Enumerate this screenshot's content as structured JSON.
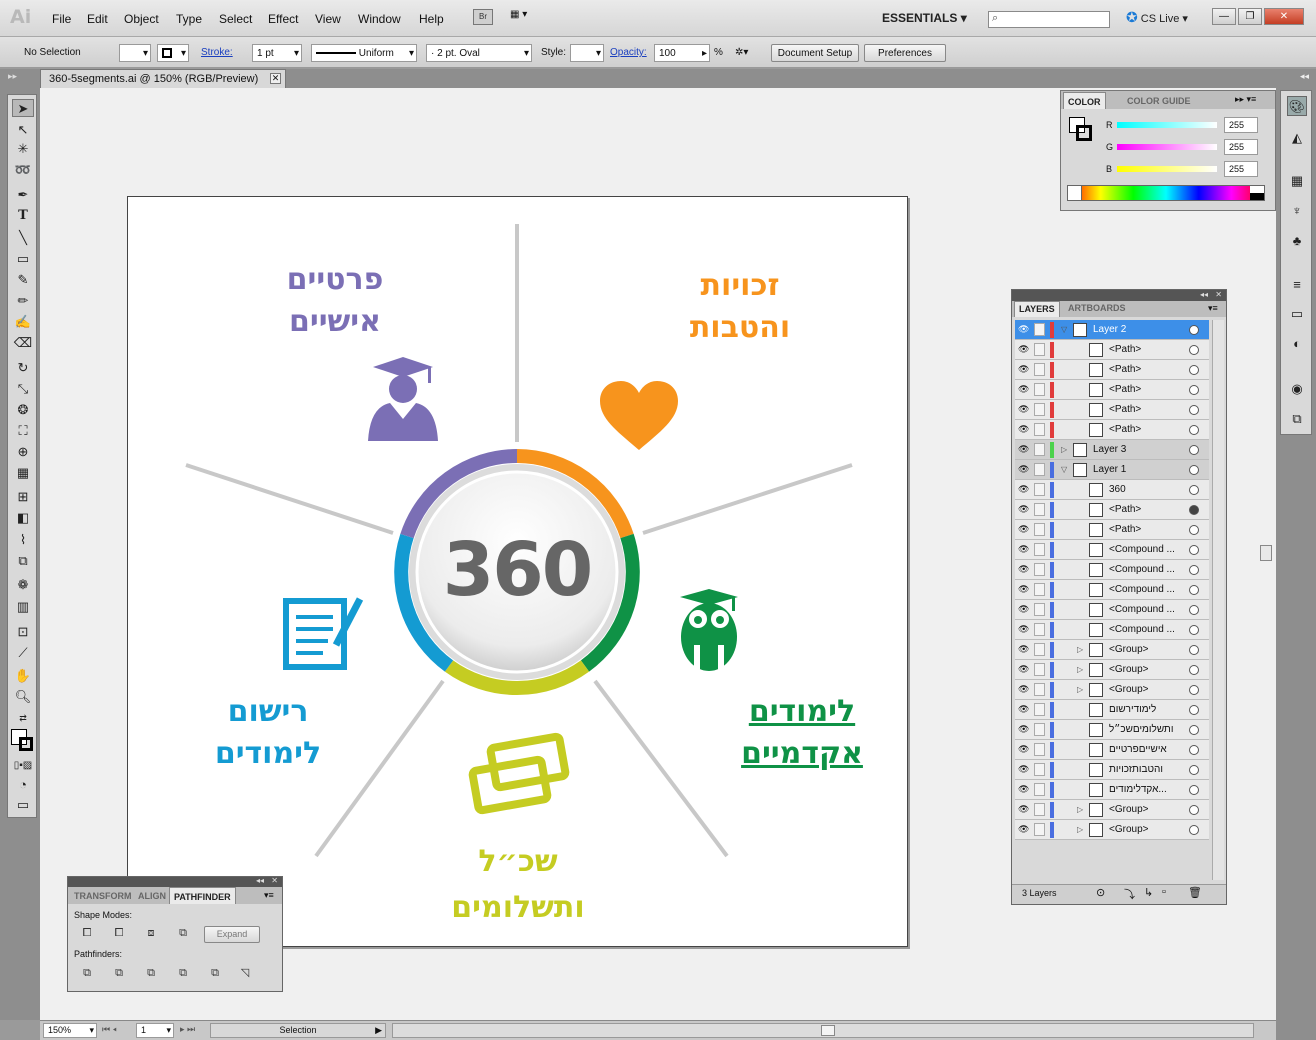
{
  "app": {
    "logo": "Ai",
    "menu": [
      "File",
      "Edit",
      "Object",
      "Type",
      "Select",
      "Effect",
      "View",
      "Window",
      "Help"
    ],
    "bridge_label": "Br",
    "workspace": "ESSENTIALS",
    "cs_live": "CS Live"
  },
  "control_bar": {
    "selection": "No Selection",
    "stroke_label": "Stroke:",
    "stroke_weight": "1 pt",
    "profile": "Uniform",
    "brush": "2 pt. Oval",
    "style_label": "Style:",
    "opacity_label": "Opacity:",
    "opacity_value": "100",
    "percent": "%",
    "doc_setup": "Document Setup",
    "preferences": "Preferences"
  },
  "document": {
    "tab_title": "360-5segments.ai @ 150% (RGB/Preview)"
  },
  "artwork": {
    "center_text": "360",
    "segments": [
      {
        "line1": "פרטיים",
        "line2": "אישיים",
        "color": "#7b6fb5"
      },
      {
        "line1": "זכויות",
        "line2": "והטבות",
        "color": "#f7941d"
      },
      {
        "line1": "לימודים",
        "line2": "אקדמיים",
        "color": "#0f9246"
      },
      {
        "line1": "שכ״ל",
        "line2": "ותשלומים",
        "color": "#c5cc22"
      },
      {
        "line1": "רישום",
        "line2": "לימודים",
        "color": "#149bd2"
      }
    ]
  },
  "color_panel": {
    "tabs": [
      "COLOR",
      "COLOR GUIDE"
    ],
    "channels": [
      {
        "label": "R",
        "value": "255",
        "color": "#26c6c6"
      },
      {
        "label": "G",
        "value": "255",
        "color": "#d830c6"
      },
      {
        "label": "B",
        "value": "255",
        "color": "#e3e330"
      }
    ]
  },
  "layers_panel": {
    "tabs": [
      "LAYERS",
      "ARTBOARDS"
    ],
    "rows": [
      {
        "name": "Layer 2",
        "kind": "layer",
        "selected": true,
        "color": "#e03c3c"
      },
      {
        "name": "<Path>",
        "kind": "item",
        "color": "#e03c3c"
      },
      {
        "name": "<Path>",
        "kind": "item",
        "color": "#e03c3c"
      },
      {
        "name": "<Path>",
        "kind": "item",
        "color": "#e03c3c"
      },
      {
        "name": "<Path>",
        "kind": "item",
        "color": "#e03c3c"
      },
      {
        "name": "<Path>",
        "kind": "item",
        "color": "#e03c3c"
      },
      {
        "name": "Layer 3",
        "kind": "layer",
        "color": "#4cd24c"
      },
      {
        "name": "Layer 1",
        "kind": "layer",
        "color": "#4a6ee0"
      },
      {
        "name": "360",
        "kind": "item",
        "color": "#4a6ee0"
      },
      {
        "name": "<Path>",
        "kind": "item",
        "color": "#4a6ee0",
        "target_filled": true
      },
      {
        "name": "<Path>",
        "kind": "item",
        "color": "#4a6ee0"
      },
      {
        "name": "<Compound ...",
        "kind": "item",
        "color": "#4a6ee0"
      },
      {
        "name": "<Compound ...",
        "kind": "item",
        "color": "#4a6ee0"
      },
      {
        "name": "<Compound ...",
        "kind": "item",
        "color": "#4a6ee0"
      },
      {
        "name": "<Compound ...",
        "kind": "item",
        "color": "#4a6ee0"
      },
      {
        "name": "<Compound ...",
        "kind": "item",
        "color": "#4a6ee0"
      },
      {
        "name": "<Group>",
        "kind": "group",
        "color": "#4a6ee0"
      },
      {
        "name": "<Group>",
        "kind": "group",
        "color": "#4a6ee0"
      },
      {
        "name": "<Group>",
        "kind": "group",
        "color": "#4a6ee0"
      },
      {
        "name": "לימודירשום",
        "kind": "item",
        "color": "#4a6ee0"
      },
      {
        "name": "ותשלומיםשכ״ל",
        "kind": "item",
        "color": "#4a6ee0"
      },
      {
        "name": "אישייםפרטיים",
        "kind": "item",
        "color": "#4a6ee0"
      },
      {
        "name": "והטבותזכויות",
        "kind": "item",
        "color": "#4a6ee0"
      },
      {
        "name": "אקדלימודים...",
        "kind": "item",
        "color": "#4a6ee0"
      },
      {
        "name": "<Group>",
        "kind": "group",
        "color": "#4a6ee0"
      },
      {
        "name": "<Group>",
        "kind": "group",
        "color": "#4a6ee0"
      }
    ],
    "footer": "3 Layers"
  },
  "pathfinder_panel": {
    "tabs": [
      "TRANSFORM",
      "ALIGN",
      "PATHFINDER"
    ],
    "shape_modes": "Shape Modes:",
    "expand": "Expand",
    "pathfinders": "Pathfinders:"
  },
  "status_bar": {
    "zoom": "150%",
    "page": "1",
    "tool": "Selection"
  }
}
